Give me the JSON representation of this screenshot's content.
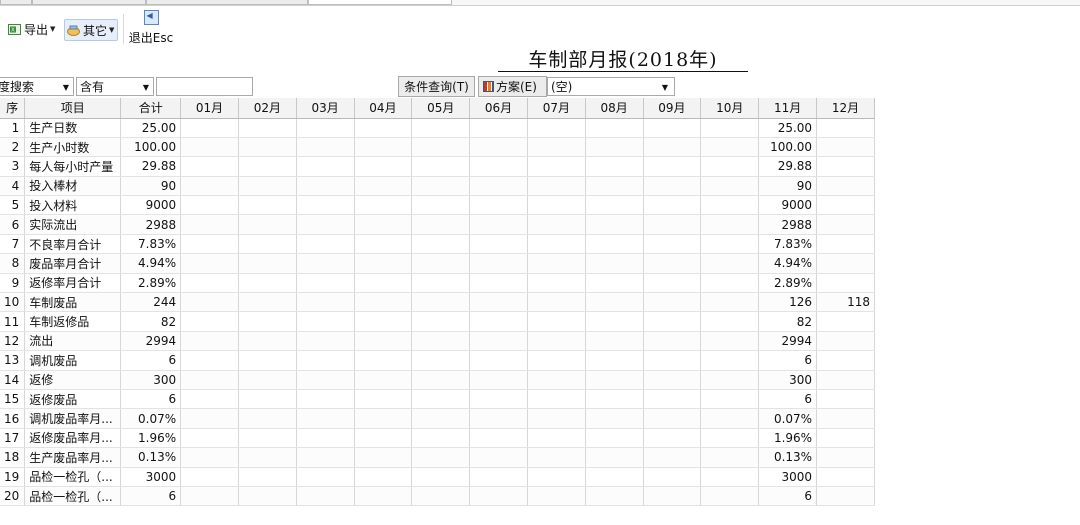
{
  "toolbar": {
    "export_label": "导出",
    "other_label": "其它",
    "exit_label": "退出Esc"
  },
  "report": {
    "title": "车制部月报(2018年)"
  },
  "filter": {
    "field_value": "度搜索",
    "operator_value": "含有",
    "keyword_value": "",
    "query_label": "条件查询(T)",
    "scheme_label": "方案(E)",
    "scheme_value": "(空)"
  },
  "grid": {
    "headers": [
      "序",
      "项目",
      "合计",
      "01月",
      "02月",
      "03月",
      "04月",
      "05月",
      "06月",
      "07月",
      "08月",
      "09月",
      "10月",
      "11月",
      "12月"
    ],
    "rows": [
      {
        "seq": "1",
        "name": "生产日数",
        "total": "25.00",
        "nov": "25.00",
        "dec": ""
      },
      {
        "seq": "2",
        "name": "生产小时数",
        "total": "100.00",
        "nov": "100.00",
        "dec": ""
      },
      {
        "seq": "3",
        "name": "每人每小时产量",
        "total": "29.88",
        "nov": "29.88",
        "dec": ""
      },
      {
        "seq": "4",
        "name": "投入棒材",
        "total": "90",
        "nov": "90",
        "dec": ""
      },
      {
        "seq": "5",
        "name": "投入材料",
        "total": "9000",
        "nov": "9000",
        "dec": ""
      },
      {
        "seq": "6",
        "name": "实际流出",
        "total": "2988",
        "nov": "2988",
        "dec": ""
      },
      {
        "seq": "7",
        "name": "不良率月合计",
        "total": "7.83%",
        "nov": "7.83%",
        "dec": ""
      },
      {
        "seq": "8",
        "name": "废品率月合计",
        "total": "4.94%",
        "nov": "4.94%",
        "dec": ""
      },
      {
        "seq": "9",
        "name": "返修率月合计",
        "total": "2.89%",
        "nov": "2.89%",
        "dec": ""
      },
      {
        "seq": "10",
        "name": "车制废品",
        "total": "244",
        "nov": "126",
        "dec": "118"
      },
      {
        "seq": "11",
        "name": "车制返修品",
        "total": "82",
        "nov": "82",
        "dec": ""
      },
      {
        "seq": "12",
        "name": "流出",
        "total": "2994",
        "nov": "2994",
        "dec": ""
      },
      {
        "seq": "13",
        "name": "调机废品",
        "total": "6",
        "nov": "6",
        "dec": ""
      },
      {
        "seq": "14",
        "name": "返修",
        "total": "300",
        "nov": "300",
        "dec": ""
      },
      {
        "seq": "15",
        "name": "返修废品",
        "total": "6",
        "nov": "6",
        "dec": ""
      },
      {
        "seq": "16",
        "name": "调机废品率月...",
        "total": "0.07%",
        "nov": "0.07%",
        "dec": ""
      },
      {
        "seq": "17",
        "name": "返修废品率月...",
        "total": "1.96%",
        "nov": "1.96%",
        "dec": ""
      },
      {
        "seq": "18",
        "name": "生产废品率月...",
        "total": "0.13%",
        "nov": "0.13%",
        "dec": ""
      },
      {
        "seq": "19",
        "name": "品检一检孔（...",
        "total": "3000",
        "nov": "3000",
        "dec": ""
      },
      {
        "seq": "20",
        "name": "品检一检孔（...",
        "total": "6",
        "nov": "6",
        "dec": ""
      }
    ]
  },
  "icons": {
    "export": "excel-export-icon",
    "other": "tools-icon",
    "exit": "exit-icon",
    "scheme": "bar-chart-icon"
  }
}
